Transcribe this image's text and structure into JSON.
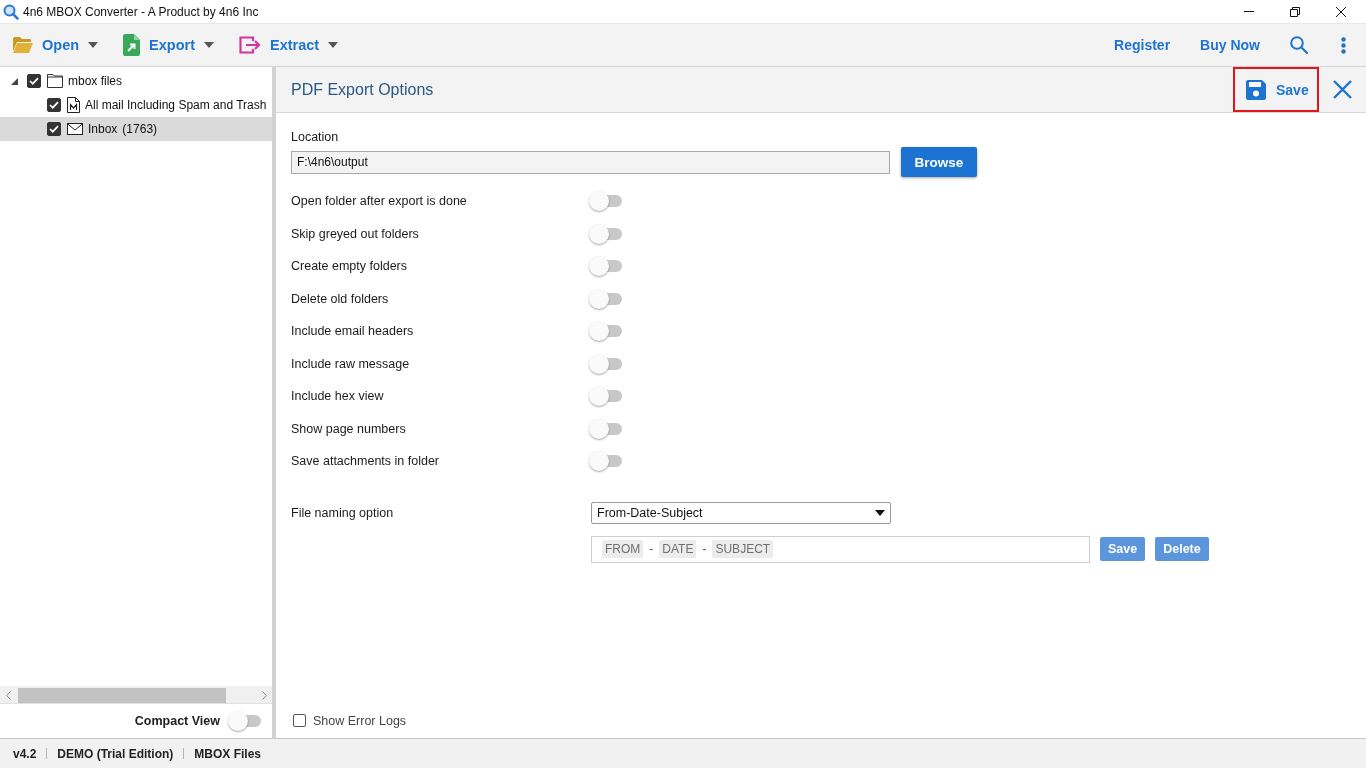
{
  "window": {
    "title": "4n6 MBOX Converter - A Product by 4n6 Inc"
  },
  "toolbar": {
    "menus": [
      {
        "kind": "open",
        "label": "Open"
      },
      {
        "kind": "export",
        "label": "Export"
      },
      {
        "kind": "extract",
        "label": "Extract"
      }
    ],
    "links": [
      "Register",
      "Buy Now"
    ]
  },
  "tree": [
    {
      "kind": "folder",
      "label": "mbox files",
      "checked": true,
      "expanded": true,
      "selected": false,
      "children": [
        {
          "kind": "mbox",
          "label": "All mail Including Spam and Trash",
          "checked": true,
          "selected": false
        },
        {
          "kind": "mail",
          "label": "Inbox",
          "count": "(1763)",
          "checked": true,
          "selected": true
        }
      ]
    }
  ],
  "compact_view": {
    "label": "Compact View",
    "on": false
  },
  "panel": {
    "title": "PDF Export Options",
    "save": {
      "label": "Save",
      "highlighted": true
    }
  },
  "location": {
    "label": "Location",
    "value": "F:\\4n6\\output",
    "button": "Browse"
  },
  "options": [
    {
      "label": "Open folder after export is done",
      "on": false
    },
    {
      "label": "Skip greyed out folders",
      "on": false
    },
    {
      "label": "Create empty folders",
      "on": false
    },
    {
      "label": "Delete old folders",
      "on": false
    },
    {
      "label": "Include email headers",
      "on": false
    },
    {
      "label": "Include raw message",
      "on": false
    },
    {
      "label": "Include hex view",
      "on": false
    },
    {
      "label": "Show page numbers",
      "on": false
    },
    {
      "label": "Save attachments in folder",
      "on": false
    }
  ],
  "file_naming": {
    "label": "File naming option",
    "value": "From-Date-Subject",
    "pattern": [
      {
        "kind": "token",
        "text": "FROM"
      },
      {
        "kind": "separator",
        "text": "-"
      },
      {
        "kind": "token",
        "text": "DATE"
      },
      {
        "kind": "separator",
        "text": "-"
      },
      {
        "kind": "token",
        "text": "SUBJECT"
      }
    ],
    "buttons": [
      {
        "label": "Save",
        "disabled": true
      },
      {
        "label": "Delete",
        "disabled": true
      }
    ]
  },
  "error_logs": {
    "label": "Show Error Logs",
    "checked": false
  },
  "status_bar": [
    "v4.2",
    "DEMO (Trial Edition)",
    "MBOX Files"
  ]
}
